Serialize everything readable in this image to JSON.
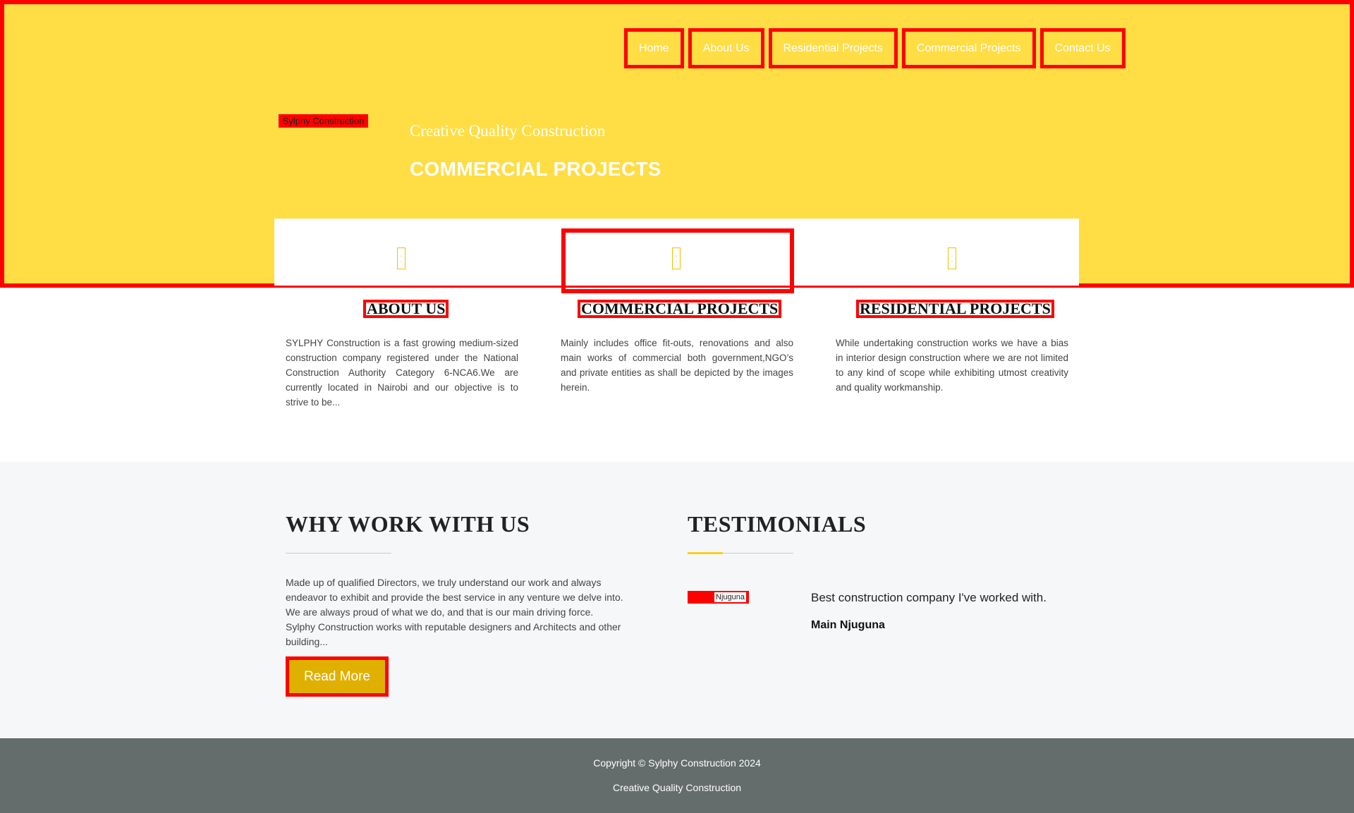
{
  "nav": {
    "items": [
      {
        "label": "Home"
      },
      {
        "label": "About Us"
      },
      {
        "label": "Residential Projects"
      },
      {
        "label": "Commercial Projects"
      },
      {
        "label": "Contact Us"
      }
    ]
  },
  "hero": {
    "logo_alt": "Sylphy Construction",
    "tagline": "Creative Quality Construction",
    "title": "COMMERCIAL PROJECTS"
  },
  "features": {
    "icon_name": "broken-image-icon"
  },
  "columns": [
    {
      "title": "ABOUT US",
      "text": "SYLPHY Construction is a fast growing medium-sized construction company registered under the National Construction Authority Category 6-NCA6.We are currently located in Nairobi and our objective is to strive to be..."
    },
    {
      "title": "COMMERCIAL PROJECTS",
      "text": "Mainly includes office fit-outs, renovations and also main works of commercial both government,NGO’s and private entities as shall be depicted by the images herein."
    },
    {
      "title": "RESIDENTIAL PROJECTS",
      "text": "While undertaking construction works we have a bias in interior design construction where we are not limited to any kind of scope while exhibiting utmost creativity and quality workmanship."
    }
  ],
  "why": {
    "heading": "WHY WORK WITH US",
    "text": "Made up of qualified Directors, we truly understand our work and always endeavor to exhibit and provide the best service in any venture we delve into. We are always proud of what we do, and that is our main driving force. Sylphy Construction works with reputable designers and Architects and other building...",
    "button_label": "Read More"
  },
  "testimonials": {
    "heading": "TESTIMONIALS",
    "avatar_alt": "Njuguna",
    "quote": "Best construction company I've worked with.",
    "author": "Main Njuguna"
  },
  "footer": {
    "copyright": "Copyright © Sylphy Construction 2024",
    "tagline": "Creative Quality Construction"
  },
  "colors": {
    "hero_bg": "#ffdd44",
    "accent": "#e0b000",
    "footer_bg": "#656c6c",
    "highlight_border": "#ff0000"
  }
}
